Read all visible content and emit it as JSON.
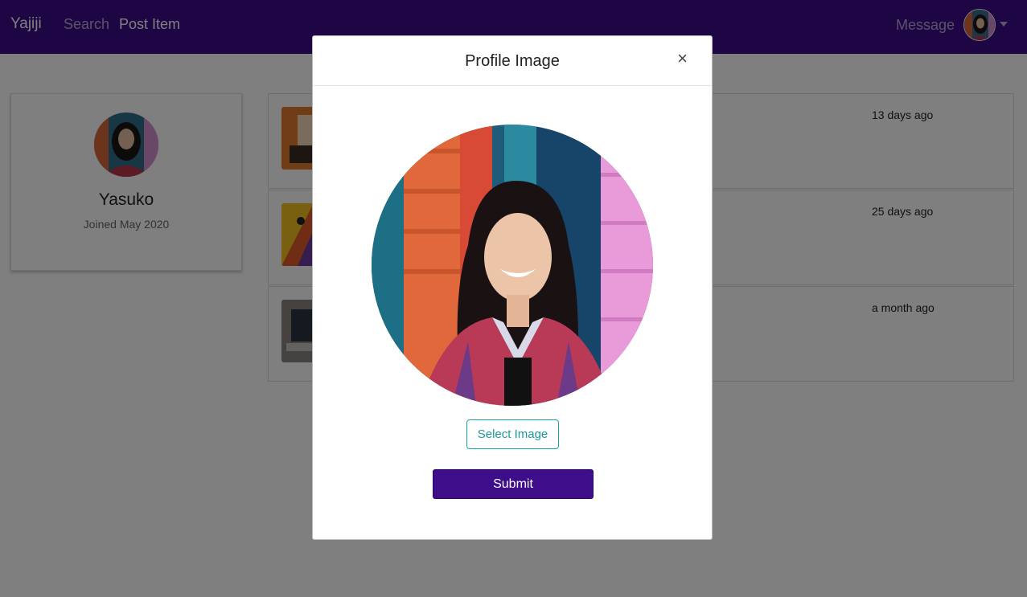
{
  "navbar": {
    "brand": "Yajiji",
    "links": [
      "Search",
      "Post Item"
    ],
    "message_label": "Message",
    "avatar_icon": "user-avatar",
    "caret_icon": "caret-down-icon"
  },
  "profile": {
    "name": "Yasuko",
    "joined": "Joined May 2020"
  },
  "items": [
    {
      "time": "13 days ago"
    },
    {
      "time": "25 days ago"
    },
    {
      "time": "a month ago"
    }
  ],
  "modal": {
    "title": "Profile Image",
    "close_symbol": "×",
    "select_label": "Select Image",
    "submit_label": "Submit"
  },
  "colors": {
    "brand": "#3d0d8a",
    "accent": "#1aa3a3"
  }
}
